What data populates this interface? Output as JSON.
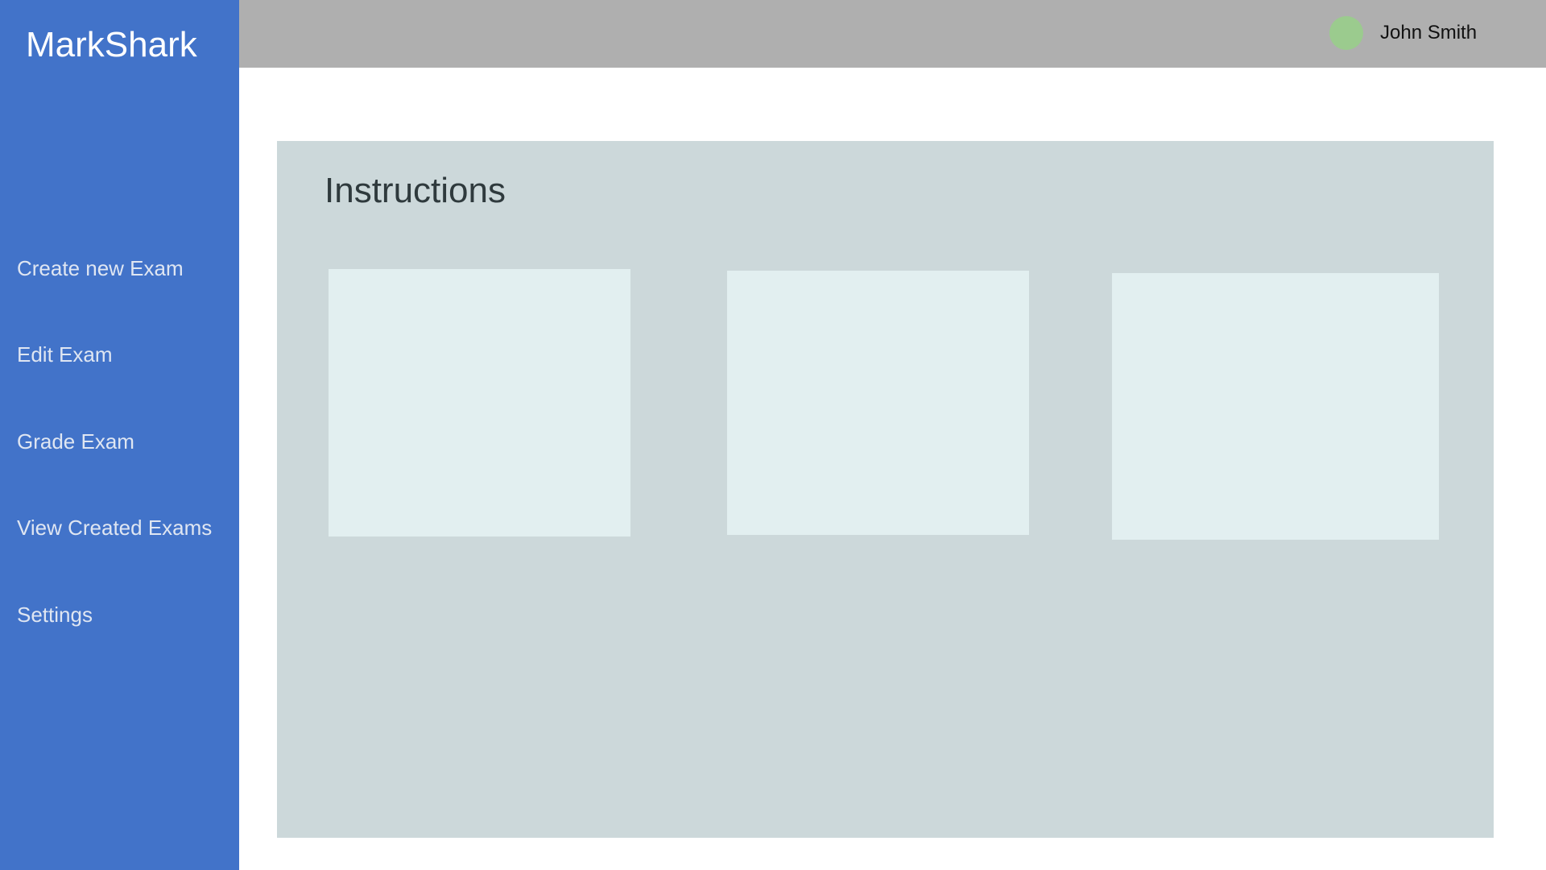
{
  "app": {
    "name": "MarkShark"
  },
  "sidebar": {
    "items": [
      {
        "label": "Create new Exam"
      },
      {
        "label": "Edit Exam"
      },
      {
        "label": "Grade Exam"
      },
      {
        "label": "View Created Exams"
      },
      {
        "label": "Settings"
      }
    ]
  },
  "header": {
    "user_name": "John Smith",
    "avatar_color": "#9bcb8e"
  },
  "main": {
    "title": "Instructions",
    "cards": [
      {
        "text": ""
      },
      {
        "text": ""
      },
      {
        "text": ""
      }
    ]
  },
  "colors": {
    "sidebar": "#4273c9",
    "topbar": "#afafaf",
    "panel": "#ccd8da",
    "card": "#e2eff0"
  }
}
